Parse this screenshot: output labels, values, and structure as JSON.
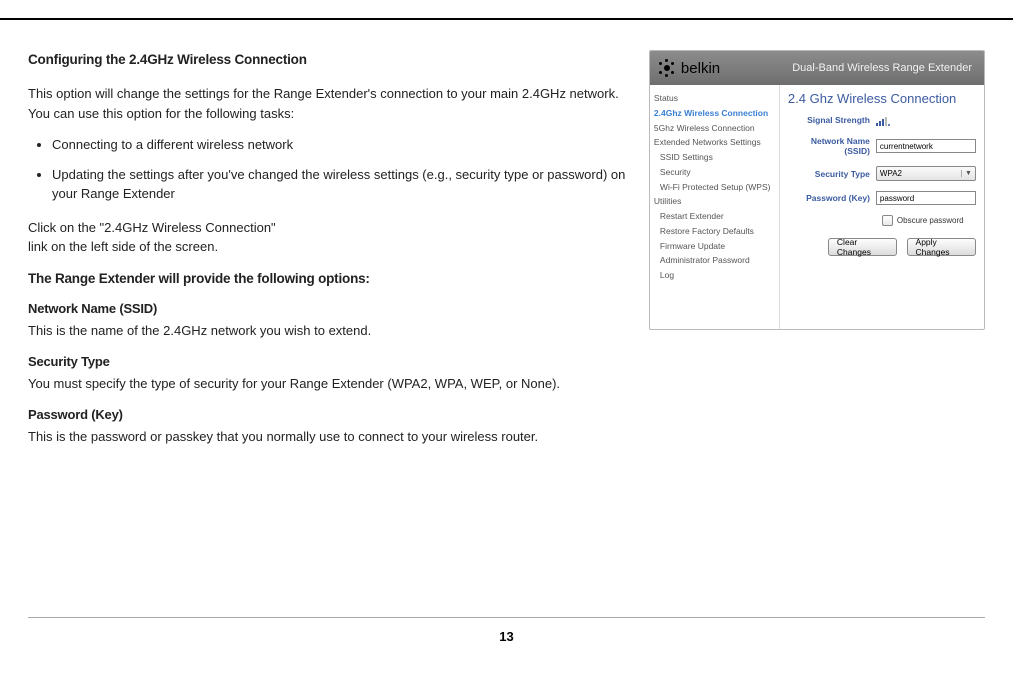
{
  "doc": {
    "heading": "Configuring the 2.4GHz Wireless Connection",
    "intro1": "This option will change the settings for the Range Extender's connection to your main 2.4GHz network. You can use this option for the following tasks:",
    "bullets": [
      "Connecting to a different wireless network",
      "Updating the settings after you've changed the wireless settings (e.g., security type or password) on your Range Extender"
    ],
    "intro2a": "Click on the \"2.4GHz Wireless Connection\"",
    "intro2b": "link on the left side of the screen.",
    "heading2": "The Range Extender will provide the following options:",
    "ssid_h": "Network Name (SSID)",
    "ssid_t": "This is the name of the 2.4GHz network you wish to extend.",
    "sec_h": "Security Type",
    "sec_t": "You must specify the type of security for your Range Extender (WPA2, WPA, WEP, or None).",
    "pwd_h": "Password (Key)",
    "pwd_t": "This is the password or passkey that you normally use to connect to your wireless router."
  },
  "app": {
    "brand": "belkin",
    "product": "Dual-Band Wireless Range Extender",
    "sidebar": {
      "items": [
        {
          "label": "Status",
          "cls": ""
        },
        {
          "label": "2.4Ghz Wireless Connection",
          "cls": "active"
        },
        {
          "label": "5Ghz Wireless Connection",
          "cls": ""
        },
        {
          "label": "Extended Networks Settings",
          "cls": ""
        },
        {
          "label": "SSID Settings",
          "cls": "sub"
        },
        {
          "label": "Security",
          "cls": "sub"
        },
        {
          "label": "Wi-Fi Protected Setup (WPS)",
          "cls": "sub"
        },
        {
          "label": "Utilities",
          "cls": ""
        },
        {
          "label": "Restart Extender",
          "cls": "sub"
        },
        {
          "label": "Restore Factory Defaults",
          "cls": "sub"
        },
        {
          "label": "Firmware Update",
          "cls": "sub"
        },
        {
          "label": "Administrator Password",
          "cls": "sub"
        },
        {
          "label": "Log",
          "cls": "sub"
        }
      ]
    },
    "form": {
      "title": "2.4 Ghz Wireless Connection",
      "signal_label": "Signal Strength",
      "ssid_label": "Network Name (SSID)",
      "ssid_value": "currentnetwork",
      "sectype_label": "Security Type",
      "sectype_value": "WPA2",
      "pwd_label": "Password (Key)",
      "pwd_value": "password",
      "obscure_label": "Obscure password",
      "clear_btn": "Clear Changes",
      "apply_btn": "Apply Changes"
    }
  },
  "page_number": "13"
}
